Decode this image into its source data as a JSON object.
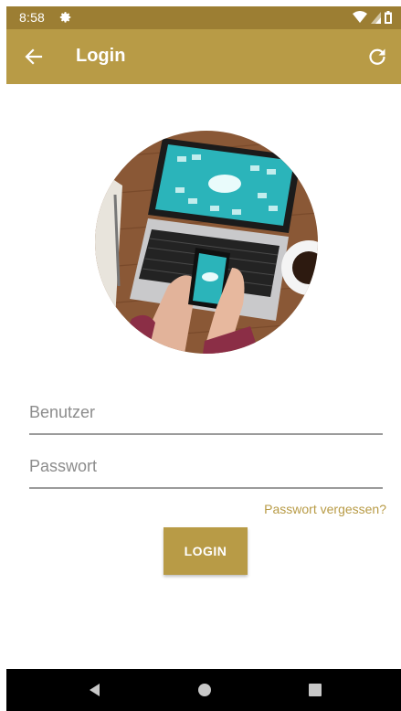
{
  "status_bar": {
    "time": "8:58",
    "icons": [
      "settings-icon",
      "wifi-icon",
      "signal-icon",
      "battery-icon"
    ]
  },
  "app_bar": {
    "title": "Login",
    "back_icon": "arrow-left-icon",
    "refresh_icon": "refresh-icon",
    "color": "#b89b46"
  },
  "hero": {
    "image": "laptop-smartphone-cloud-photo"
  },
  "form": {
    "username_placeholder": "Benutzer",
    "username_value": "",
    "password_placeholder": "Passwort",
    "password_value": "",
    "forgot_label": "Passwort vergessen?",
    "login_label": "LOGIN"
  },
  "nav_bar": {
    "icons": [
      "back-triangle-icon",
      "home-circle-icon",
      "recents-square-icon"
    ]
  },
  "colors": {
    "accent": "#b89b46",
    "status_bar": "#9c7e33"
  }
}
